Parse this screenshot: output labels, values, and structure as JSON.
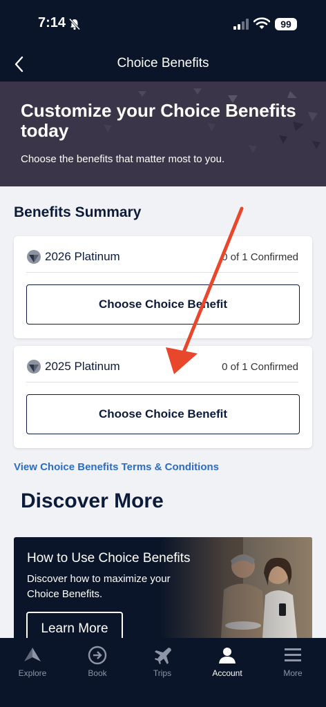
{
  "status_bar": {
    "time": "7:14",
    "battery": "99"
  },
  "header": {
    "title": "Choice Benefits"
  },
  "hero": {
    "title": "Customize your Choice Benefits today",
    "subtitle": "Choose the benefits that matter most to you."
  },
  "summary": {
    "title": "Benefits Summary",
    "cards": [
      {
        "tier": "2026 Platinum",
        "status": "0 of 1 Confirmed",
        "button": "Choose Choice Benefit"
      },
      {
        "tier": "2025 Platinum",
        "status": "0 of 1 Confirmed",
        "button": "Choose Choice Benefit"
      }
    ]
  },
  "terms_link": "View Choice Benefits Terms & Conditions",
  "discover": {
    "title": "Discover More",
    "promo": {
      "title": "How to Use Choice Benefits",
      "description": "Discover how to maximize your Choice Benefits.",
      "button": "Learn More"
    }
  },
  "tabs": [
    {
      "label": "Explore",
      "icon": "delta-widget-icon"
    },
    {
      "label": "Book",
      "icon": "arrow-circle-icon"
    },
    {
      "label": "Trips",
      "icon": "airplane-icon"
    },
    {
      "label": "Account",
      "icon": "person-icon",
      "active": true
    },
    {
      "label": "More",
      "icon": "menu-icon"
    }
  ],
  "colors": {
    "navy": "#0b1529",
    "hero_bg": "#3a3549",
    "link": "#2b6cc4",
    "annotation_arrow": "#e8472b",
    "page_bg": "#f0f2f5"
  }
}
